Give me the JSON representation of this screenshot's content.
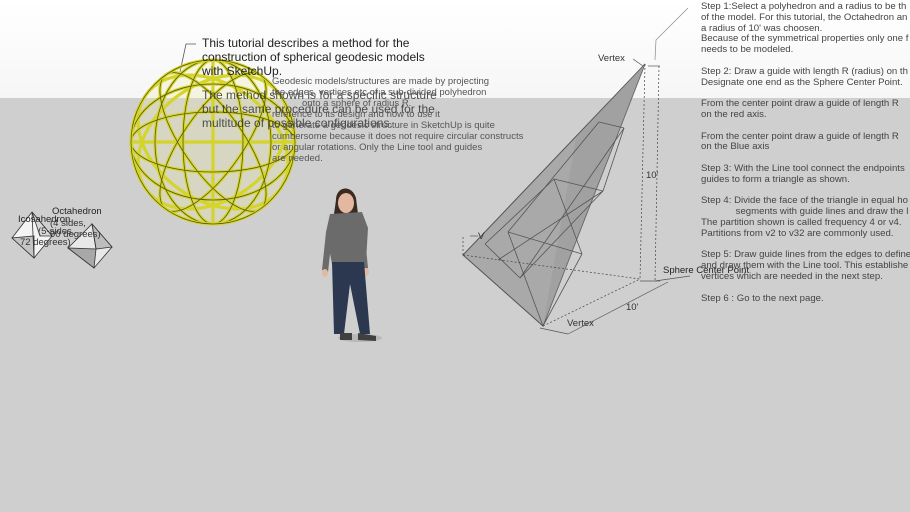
{
  "scene": {
    "intro": {
      "line1": "This tutorial describes a method for the",
      "line2": "construction of spherical geodesic models",
      "line3": "with SketchUp.",
      "overlay1": "The method shown is for a specific structure",
      "overlay2": "but the same procedure can be used for the",
      "overlay3": "multitude of possible configurations."
    },
    "geodesic_text": [
      "Geodesic models/structures are made by projecting",
      "the edges, vertices etc of a sub-divided polyhedron",
      "onto a sphere of radius R.",
      "reference to its design and how to use it",
      "to generate a geodesic structure in SketchUp is quite",
      "cumbersome because it does not require circular constructs",
      "or angular rotations. Only the Line tool and guides",
      "are needed."
    ],
    "polyhedra": {
      "octahedron": "Octahedron",
      "octahedron_sides": "(4 sides,",
      "octahedron_deg": "90 degrees)",
      "icosahedron": "Icosahedron",
      "icosahedron_sides": "(5-sides,",
      "icosahedron_deg": "72 degrees)"
    },
    "dims": {
      "vertex_top": "Vertex",
      "vertex_bottom": "Vertex",
      "vertex_left": "V",
      "height": "10'",
      "base": "10'",
      "center": "Sphere Center Point"
    },
    "steps": [
      "Step 1:Select a polyhedron and a radius to be th",
      "of the model. For this tutorial, the Octahedron an",
      "a radius of 10' was choosen.",
      "Because of the symmetrical properties only one f",
      "needs to be modeled.",
      "",
      "Step 2:  Draw a guide with length R (radius) on th",
      "Designate one end as the Sphere Center Point.",
      "",
      "From the center point draw a guide of length R",
      "on the red axis.",
      "",
      "From the center point draw a guide of length R",
      "on the Blue axis",
      "",
      "Step 3: With the Line tool connect the endpoints",
      "guides to form a triangle as shown.",
      "",
      "Step 4: Divide the face of the triangle in equal ho",
      "             segments with guide lines and draw the l",
      "The partition shown is called frequency 4 or v4.",
      "Partitions from v2 to v32 are commonly used.",
      "",
      "Step 5: Draw guide lines from the edges to define",
      "and draw them with the Line tool. This establishe",
      "vertices which are needed in the next step.",
      "",
      "Step 6 : Go to the next page."
    ]
  },
  "colors": {
    "sky": "#ffffff",
    "ground": "#cfcfcf",
    "geodesic": "#d7d72a",
    "face": "#a9a9a9"
  }
}
